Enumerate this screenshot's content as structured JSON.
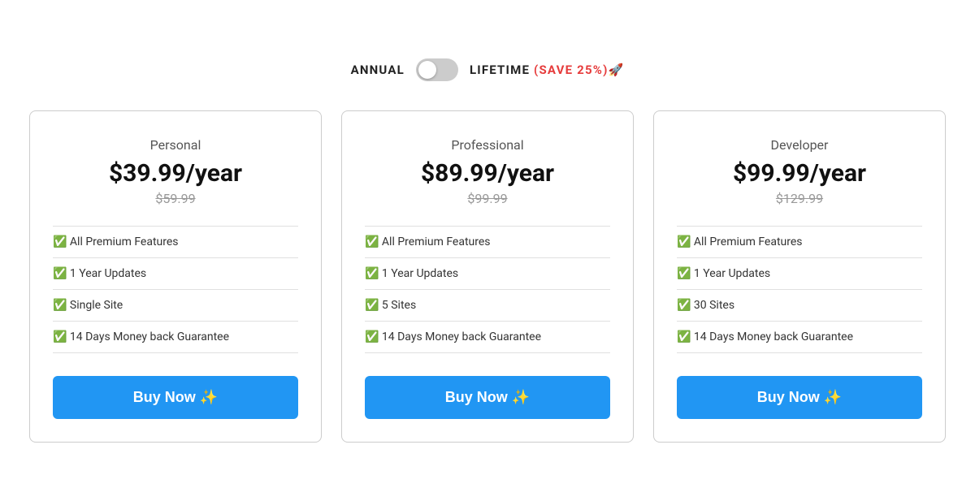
{
  "toggle": {
    "annual_label": "ANNUAL",
    "lifetime_label": "LIFETIME",
    "save_label": "(SAVE 25%)🚀"
  },
  "plans": [
    {
      "name": "Personal",
      "price": "$39.99/year",
      "original_price": "$59.99",
      "features": [
        "✅ All Premium Features",
        "✅ 1 Year Updates",
        "✅ Single Site",
        "✅ 14 Days Money back Guarantee"
      ],
      "button_label": "Buy Now ✨"
    },
    {
      "name": "Professional",
      "price": "$89.99/year",
      "original_price": "$99.99",
      "features": [
        "✅ All Premium Features",
        "✅ 1 Year Updates",
        "✅ 5 Sites",
        "✅ 14 Days Money back Guarantee"
      ],
      "button_label": "Buy Now ✨"
    },
    {
      "name": "Developer",
      "price": "$99.99/year",
      "original_price": "$129.99",
      "features": [
        "✅ All Premium Features",
        "✅ 1 Year Updates",
        "✅ 30 Sites",
        "✅ 14 Days Money back Guarantee"
      ],
      "button_label": "Buy Now ✨"
    }
  ]
}
